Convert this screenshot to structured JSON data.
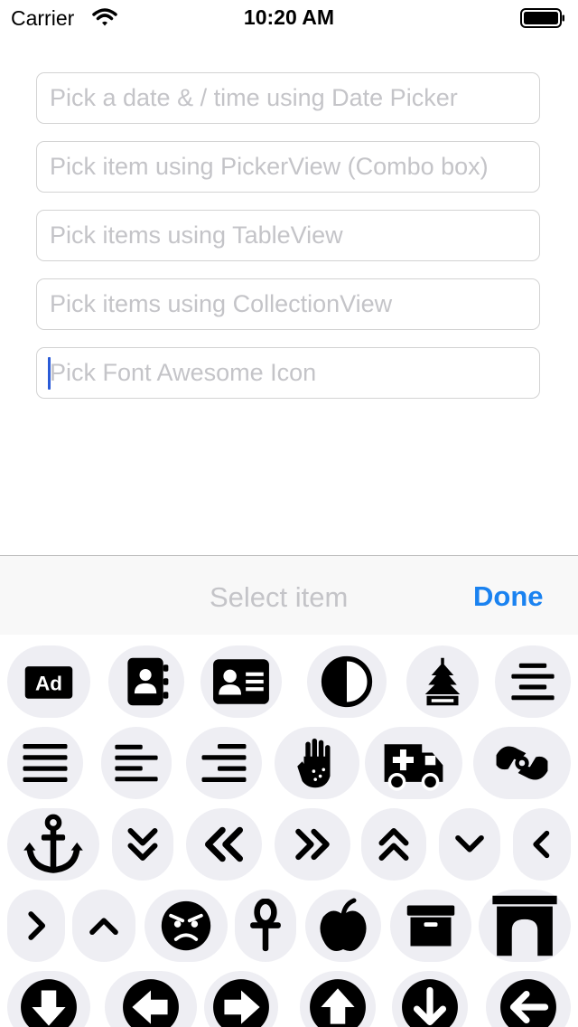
{
  "status_bar": {
    "carrier": "Carrier",
    "time": "10:20 AM"
  },
  "form": {
    "fields": [
      {
        "placeholder": "Pick a date & / time using Date Picker"
      },
      {
        "placeholder": "Pick item using PickerView (Combo box)"
      },
      {
        "placeholder": "Pick items using TableView"
      },
      {
        "placeholder": "Pick items using CollectionView"
      },
      {
        "placeholder": "Pick Font Awesome Icon"
      }
    ]
  },
  "picker_toolbar": {
    "title": "Select item",
    "done_label": "Done"
  },
  "icon_grid": {
    "selected": null,
    "items": [
      {
        "icon": "ad"
      },
      {
        "icon": "address-book"
      },
      {
        "icon": "address-card"
      },
      {
        "icon": "adjust"
      },
      {
        "icon": "air-freshener"
      },
      {
        "icon": "align-center"
      },
      {
        "icon": "align-justify"
      },
      {
        "icon": "align-left"
      },
      {
        "icon": "align-right"
      },
      {
        "icon": "allergies"
      },
      {
        "icon": "ambulance"
      },
      {
        "icon": "american-sign-language-interpreting"
      },
      {
        "icon": "anchor"
      },
      {
        "icon": "angle-double-down"
      },
      {
        "icon": "angle-double-left"
      },
      {
        "icon": "angle-double-right"
      },
      {
        "icon": "angle-double-up"
      },
      {
        "icon": "angle-down"
      },
      {
        "icon": "angle-left"
      },
      {
        "icon": "angle-right"
      },
      {
        "icon": "angle-up"
      },
      {
        "icon": "angry"
      },
      {
        "icon": "ankh"
      },
      {
        "icon": "apple-alt"
      },
      {
        "icon": "archive"
      },
      {
        "icon": "archway"
      },
      {
        "icon": "arrow-alt-circle-down"
      },
      {
        "icon": "arrow-alt-circle-left"
      },
      {
        "icon": "arrow-alt-circle-right"
      },
      {
        "icon": "arrow-alt-circle-up"
      },
      {
        "icon": "arrow-circle-down"
      },
      {
        "icon": "arrow-circle-left"
      }
    ]
  }
}
